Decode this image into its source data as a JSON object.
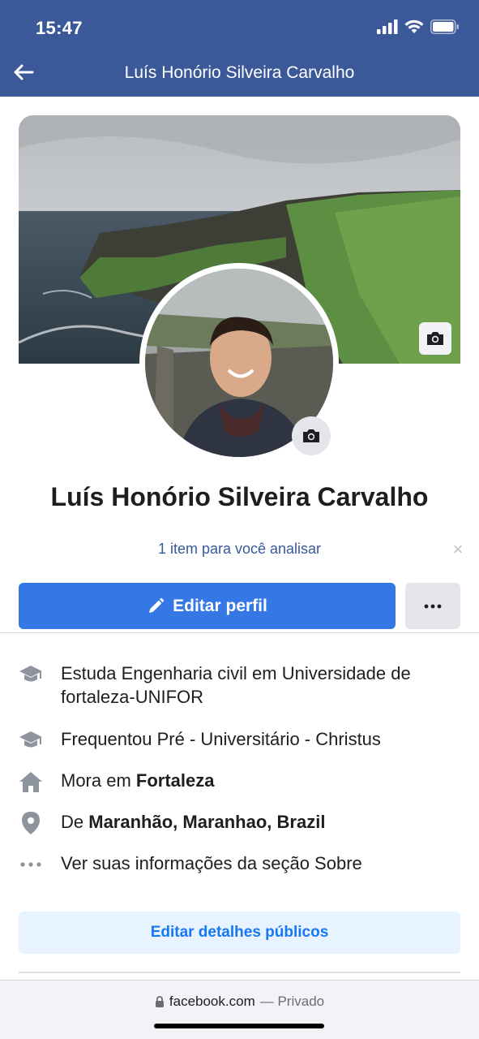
{
  "status_bar": {
    "time": "15:47"
  },
  "nav": {
    "title": "Luís Honório Silveira Carvalho"
  },
  "profile": {
    "name": "Luís Honório Silveira Carvalho",
    "review_link": "1 item para você analisar",
    "edit_profile_label": "Editar perfil"
  },
  "info": [
    {
      "icon": "graduation-cap-icon",
      "prefix": "Estuda Engenharia civil em Universidade de fortaleza-UNIFOR",
      "bold": ""
    },
    {
      "icon": "graduation-cap-icon",
      "prefix": "Frequentou Pré - Universitário - Christus",
      "bold": ""
    },
    {
      "icon": "home-icon",
      "prefix": "Mora em ",
      "bold": "Fortaleza"
    },
    {
      "icon": "location-pin-icon",
      "prefix": "De ",
      "bold": "Maranhão, Maranhao, Brazil"
    },
    {
      "icon": "more-dots-icon",
      "prefix": "Ver suas informações da seção Sobre",
      "bold": ""
    }
  ],
  "edit_details_label": "Editar detalhes públicos",
  "browser": {
    "domain": "facebook.com",
    "privacy": "— Privado"
  },
  "colors": {
    "header": "#3b5998",
    "primary_button": "#3578e5",
    "link": "#385898"
  }
}
